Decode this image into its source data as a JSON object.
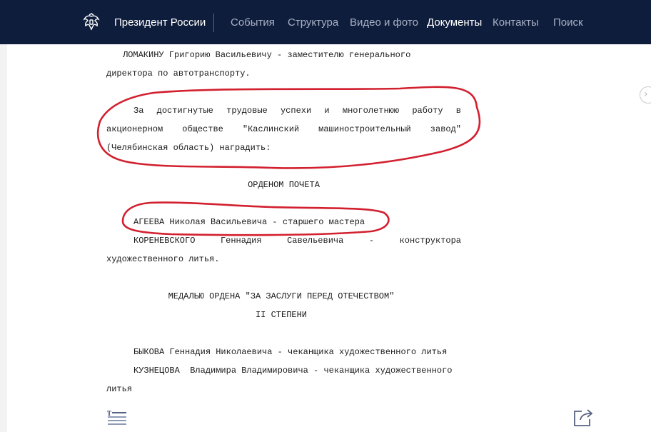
{
  "header": {
    "brand": "Президент России",
    "nav": [
      {
        "label": "События",
        "active": false
      },
      {
        "label": "Структура",
        "active": false
      },
      {
        "label": "Видео и фото",
        "active": false
      },
      {
        "label": "Документы",
        "active": true
      },
      {
        "label": "Контакты",
        "active": false
      },
      {
        "label": "Поиск",
        "active": false
      }
    ]
  },
  "document": {
    "p_lomakin_1": "ЛОМАКИНУ Григорию Васильевичу - заместителю генерального",
    "p_lomakin_2": "директора по автотранспорту.",
    "p_kaslin_1": "За  достигнутые  трудовые  успехи  и  многолетнюю  работу  в",
    "p_kaslin_2": "акционерном   обществе   \"Каслинский   машиностроительный   завод\"",
    "p_kaslin_3": "(Челябинская область) наградить:",
    "order_heading": "ОРДЕНОМ ПОЧЕТА",
    "p_ageev": "АГЕЕВА Николая Васильевича - старшего мастера",
    "p_korenev_1": "КОРЕНЕВСКОГО   Геннадия   Савельевича   -   конструктора",
    "p_korenev_2": "художественного литья.",
    "medal_heading_1": "МЕДАЛЬЮ ОРДЕНА \"ЗА ЗАСЛУГИ ПЕРЕД ОТЕЧЕСТВОМ\"",
    "medal_heading_2": "II СТЕПЕНИ",
    "p_bykov": "БЫКОВА Геннадия Николаевича - чеканщика художественного литья",
    "p_kuznetsov_1": "КУЗНЕЦОВА  Владимира Владимировича - чеканщика художественного",
    "p_kuznetsov_2": "литья"
  },
  "colors": {
    "header_bg": "#0f1d3c",
    "annotation": "#d2202f",
    "nav_inactive": "#a8b0c4",
    "nav_active": "#ffffff"
  },
  "icons": {
    "emblem": "double-headed-eagle-emblem",
    "side": "chevron-right-icon",
    "toc": "table-of-contents-icon",
    "share": "share-icon"
  }
}
